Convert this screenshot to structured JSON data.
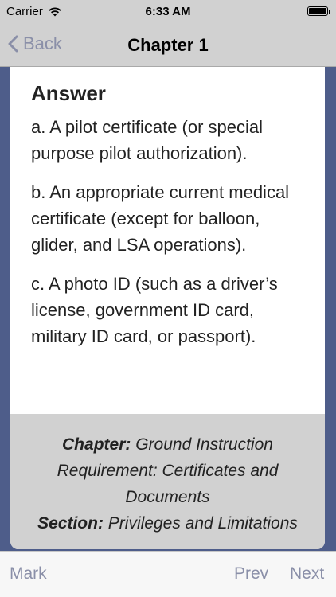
{
  "status_bar": {
    "carrier": "Carrier",
    "time": "6:33 AM",
    "icons": [
      "wifi-icon",
      "battery-icon"
    ]
  },
  "nav": {
    "back_label": "Back",
    "title": "Chapter 1"
  },
  "answer": {
    "heading": "Answer",
    "items": [
      "a. A pilot certificate (or special purpose pilot authorization).",
      "b. An appropriate current medical certificate (except for balloon, glider, and LSA operations).",
      "c. A photo ID (such as a driver’s license, government ID card, military ID card, or passport)."
    ]
  },
  "footer": {
    "chapter_label": "Chapter:",
    "chapter_value": "Ground Instruction Requirement: Certificates and Documents",
    "section_label": "Section:",
    "section_value": "Privileges and Limitations"
  },
  "toolbar": {
    "mark_label": "Mark",
    "prev_label": "Prev",
    "next_label": "Next"
  },
  "colors": {
    "background": "#4e5d8a",
    "bar_gray": "#d1d1d1",
    "tint": "#8a8fa8"
  }
}
